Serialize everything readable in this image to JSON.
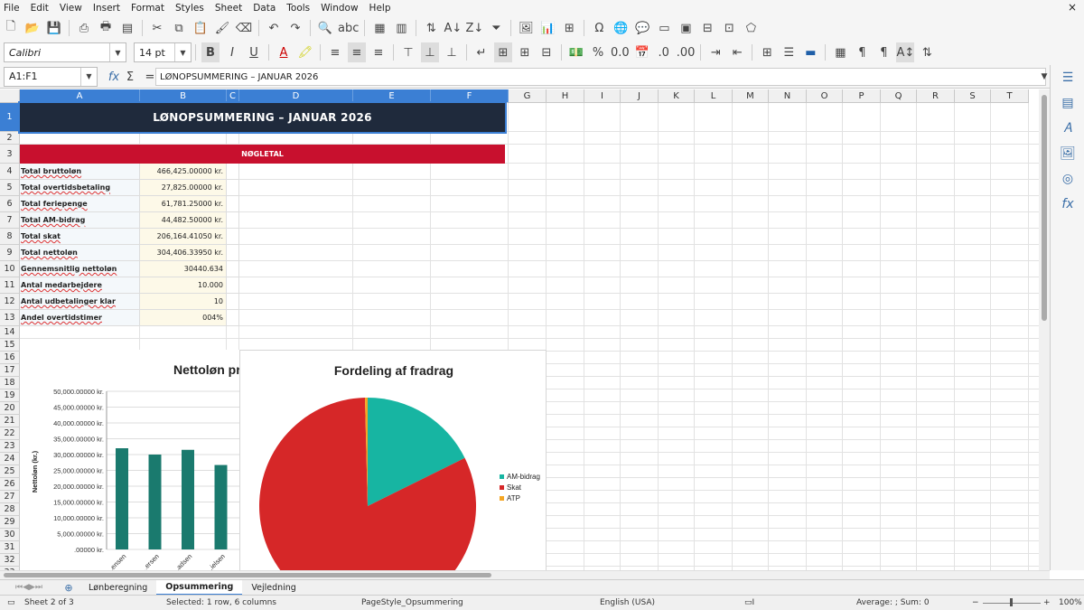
{
  "menu": [
    "File",
    "Edit",
    "View",
    "Insert",
    "Format",
    "Styles",
    "Sheet",
    "Data",
    "Tools",
    "Window",
    "Help"
  ],
  "close_glyph": "×",
  "font_name": "Calibri",
  "font_size": "14 pt",
  "name_box": "A1:F1",
  "formula": "LØNOPSUMMERING – JANUAR 2026",
  "columns": [
    "A",
    "B",
    "C",
    "D",
    "E",
    "F",
    "G",
    "H",
    "I",
    "J",
    "K",
    "L",
    "M",
    "N",
    "O",
    "P",
    "Q",
    "R",
    "S",
    "T"
  ],
  "rows": [
    "1",
    "2",
    "3",
    "4",
    "5",
    "6",
    "7",
    "8",
    "9",
    "10",
    "11",
    "12",
    "13",
    "14",
    "15",
    "16",
    "17",
    "18",
    "19",
    "20",
    "21",
    "22",
    "23",
    "24",
    "25",
    "26",
    "27",
    "28",
    "29",
    "30",
    "31",
    "32",
    "33"
  ],
  "title": "LØNOPSUMMERING – JANUAR 2026",
  "section_header": "NØGLETAL",
  "kpis": [
    {
      "label": "Total bruttoløn",
      "value": "466,425.00000 kr."
    },
    {
      "label": "Total overtidsbetaling",
      "value": "27,825.00000 kr."
    },
    {
      "label": "Total feriepenge",
      "value": "61,781.25000 kr."
    },
    {
      "label": "Total AM-bidrag",
      "value": "44,482.50000 kr."
    },
    {
      "label": "Total skat",
      "value": "206,164.41050 kr."
    },
    {
      "label": "Total nettoløn",
      "value": "304,406.33950 kr."
    },
    {
      "label": "Gennemsnitlig nettoløn",
      "value": "30440.634"
    },
    {
      "label": "Antal medarbejdere",
      "value": "10.000"
    },
    {
      "label": "Antal udbetalinger klar",
      "value": "10"
    },
    {
      "label": "Andel overtidstimer",
      "value": "004%"
    }
  ],
  "chart_data": [
    {
      "type": "bar",
      "title": "Nettoløn pr",
      "ylabel": "Nettoløn (kr.)",
      "ylim": [
        0,
        50000
      ],
      "yticks": [
        ".00000 kr.",
        "5,000.00000 kr.",
        "10,000.00000 kr.",
        "15,000.00000 kr.",
        "20,000.00000 kr.",
        "25,000.00000 kr.",
        "30,000.00000 kr.",
        "35,000.00000 kr.",
        "40,000.00000 kr.",
        "45,000.00000 kr.",
        "50,000.00000 kr."
      ],
      "categories": [
        "...ensen",
        "...ersen",
        "...adsen",
        "...ielsen"
      ],
      "values": [
        32000,
        30000,
        31500,
        26700
      ],
      "color": "#1a7a6e"
    },
    {
      "type": "pie",
      "title": "Fordeling af fradrag",
      "series": [
        {
          "name": "AM-bidrag",
          "value": 44482.5,
          "color": "#17b5a2"
        },
        {
          "name": "Skat",
          "value": 206164.4105,
          "color": "#d62728"
        },
        {
          "name": "ATP",
          "value": 1000,
          "color": "#f5a623"
        }
      ],
      "legend": "right"
    }
  ],
  "sheet_tabs": [
    "Lønberegning",
    "Opsummering",
    "Vejledning"
  ],
  "active_tab": "Opsummering",
  "status": {
    "sheet": "Sheet 2 of 3",
    "selection": "Selected: 1 row, 6 columns",
    "page_style": "PageStyle_Opsummering",
    "language": "English (USA)",
    "sum": "Average: ; Sum: 0",
    "zoom": "100%"
  }
}
